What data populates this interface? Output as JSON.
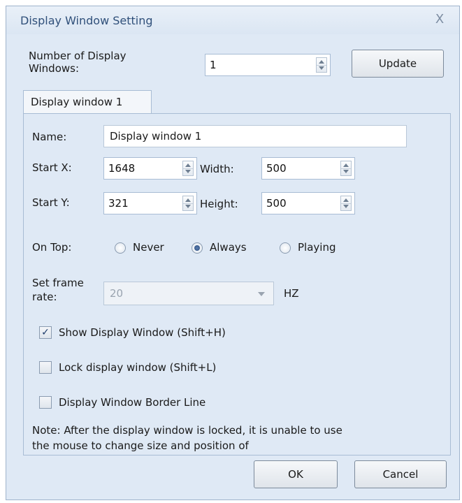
{
  "window": {
    "title": "Display Window Setting",
    "close_glyph": "X"
  },
  "count": {
    "label": "Number of Display Windows:",
    "value": "1",
    "update_label": "Update"
  },
  "tab": {
    "label": "Display window 1"
  },
  "form": {
    "name_label": "Name:",
    "name_value": "Display window 1",
    "start_x_label": "Start X:",
    "start_x_value": "1648",
    "width_label": "Width:",
    "width_value": "500",
    "start_y_label": "Start Y:",
    "start_y_value": "321",
    "height_label": "Height:",
    "height_value": "500",
    "on_top_label": "On Top:",
    "on_top_options": [
      "Never",
      "Always",
      "Playing"
    ],
    "on_top_selected": "Always",
    "frame_rate_label": "Set frame rate:",
    "frame_rate_value": "20",
    "frame_rate_unit": "HZ",
    "show_display": {
      "label": "Show Display Window (Shift+H)",
      "checked": true
    },
    "lock_display": {
      "label": "Lock display window (Shift+L)",
      "checked": false
    },
    "border_line": {
      "label": "Display Window Border Line",
      "checked": false
    },
    "note": "Note: After the display window is locked, it is unable to use the mouse to change size and position of"
  },
  "footer": {
    "ok_label": "OK",
    "cancel_label": "Cancel"
  },
  "colors": {
    "dialog_bg": "#dfe9f5",
    "title_text": "#30507a",
    "accent": "#2a4a7c"
  }
}
